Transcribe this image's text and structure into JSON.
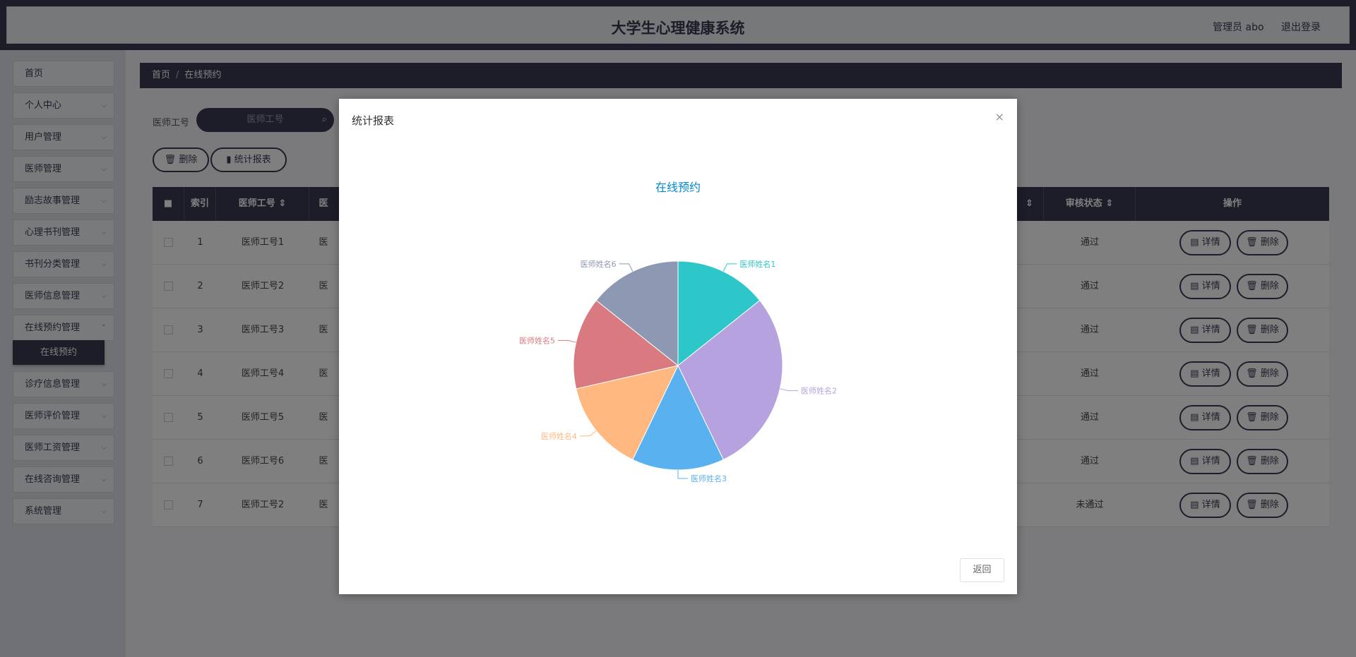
{
  "header": {
    "title": "大学生心理健康系统",
    "user": "管理员 abo",
    "logout": "退出登录"
  },
  "sidebar": {
    "items": [
      {
        "label": "首页"
      },
      {
        "label": "个人中心"
      },
      {
        "label": "用户管理"
      },
      {
        "label": "医师管理"
      },
      {
        "label": "励志故事管理"
      },
      {
        "label": "心理书刊管理"
      },
      {
        "label": "书刊分类管理"
      },
      {
        "label": "医师信息管理"
      },
      {
        "label": "在线预约管理"
      },
      {
        "label": "诊疗信息管理"
      },
      {
        "label": "医师评价管理"
      },
      {
        "label": "医师工资管理"
      },
      {
        "label": "在线咨询管理"
      },
      {
        "label": "系统管理"
      }
    ],
    "active_sub": "在线预约"
  },
  "breadcrumb": {
    "home": "首页",
    "sep": "/",
    "current": "在线预约"
  },
  "search": {
    "label": "医师工号",
    "placeholder": "医师工号"
  },
  "toolbar": {
    "delete": "删除",
    "report": "统计报表"
  },
  "table": {
    "headers": {
      "index": "索引",
      "doctor_id": "医师工号",
      "col3": "医",
      "col_sort": "",
      "status": "审核状态",
      "ops": "操作"
    },
    "rows": [
      {
        "index": "1",
        "doctor_id": "医师工号1",
        "col3": "医",
        "status": "通过"
      },
      {
        "index": "2",
        "doctor_id": "医师工号2",
        "col3": "医",
        "status": "通过"
      },
      {
        "index": "3",
        "doctor_id": "医师工号3",
        "col3": "医",
        "status": "通过"
      },
      {
        "index": "4",
        "doctor_id": "医师工号4",
        "col3": "医",
        "status": "通过"
      },
      {
        "index": "5",
        "doctor_id": "医师工号5",
        "col3": "医",
        "status": "通过"
      },
      {
        "index": "6",
        "doctor_id": "医师工号6",
        "col3": "医",
        "status": "通过"
      },
      {
        "index": "7",
        "doctor_id": "医师工号2",
        "col3": "医",
        "status": "未通过"
      }
    ],
    "detail_label": "详情",
    "delete_label": "删除"
  },
  "dialog": {
    "title": "统计报表",
    "close": "×",
    "back": "返回"
  },
  "chart_data": {
    "type": "pie",
    "title": "在线预约",
    "categories": [
      "医师姓名1",
      "医师姓名2",
      "医师姓名3",
      "医师姓名4",
      "医师姓名5",
      "医师姓名6"
    ],
    "values": [
      1,
      2,
      1,
      1,
      1,
      1
    ],
    "colors": [
      "#2ec7c9",
      "#b6a2de",
      "#5ab1ef",
      "#ffb980",
      "#d87a80",
      "#8d98b3"
    ]
  }
}
